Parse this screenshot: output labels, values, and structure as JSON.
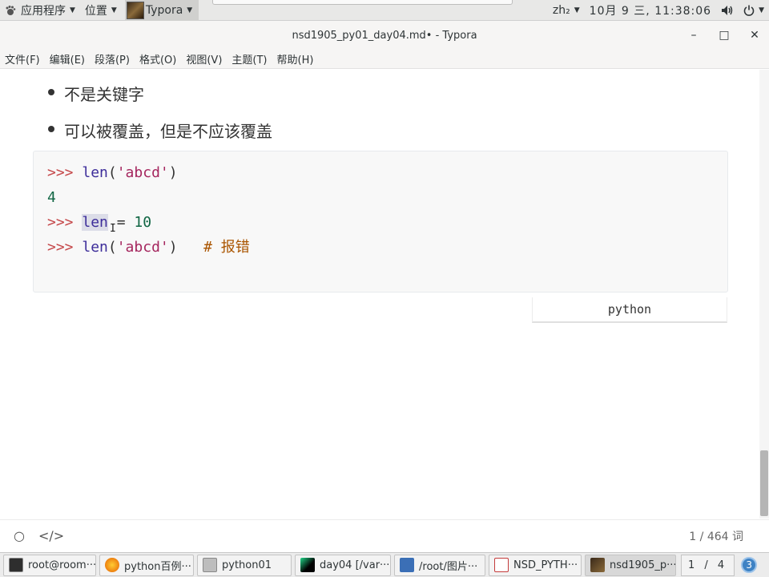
{
  "top_panel": {
    "apps_menu": "应用程序",
    "places_menu": "位置",
    "active_app": "Typora",
    "input_method": "zh₂",
    "clock": "10月  9 三, 11:38:06"
  },
  "window": {
    "title": "nsd1905_py01_day04.md• - Typora"
  },
  "menubar": {
    "items": [
      "文件(F)",
      "编辑(E)",
      "段落(P)",
      "格式(O)",
      "视图(V)",
      "主题(T)",
      "帮助(H)"
    ]
  },
  "content": {
    "bullets": [
      "不是关键字",
      "可以被覆盖，但是不应该覆盖"
    ],
    "code": {
      "line1": {
        "prompt": ">>>",
        "func": "len",
        "open": "(",
        "arg": "'abcd'",
        "close": ")"
      },
      "line2": {
        "output": "4"
      },
      "line3": {
        "prompt": ">>>",
        "name_hl": "len",
        "assign": " = ",
        "value": "10"
      },
      "line4": {
        "prompt": ">>>",
        "func": "len",
        "open": "(",
        "arg": "'abcd'",
        "close": ")",
        "comment": "# 报错"
      }
    },
    "language": "python"
  },
  "footer": {
    "word_count": "1 / 464 词"
  },
  "taskbar": {
    "tasks": [
      {
        "label": "root@room···",
        "icon_color": "#2e2e2e"
      },
      {
        "label": "python百例···",
        "icon_color": "#e66000"
      },
      {
        "label": "python01",
        "icon_color": "#9a9a9a"
      },
      {
        "label": "day04 [/var···",
        "icon_color": "#21d789"
      },
      {
        "label": "/root/图片···",
        "icon_color": "#3b6fb6"
      },
      {
        "label": "NSD_PYTH···",
        "icon_color": "#c43c3c"
      },
      {
        "label": "nsd1905_p···",
        "icon_color": "#4a3a20"
      }
    ],
    "workspace": "1 / 4",
    "badge": "3"
  },
  "colors": {
    "prompt": "#c5484a",
    "builtin": "#3d2d9a",
    "string": "#a5265e",
    "number": "#116644",
    "comment": "#aa5500"
  }
}
